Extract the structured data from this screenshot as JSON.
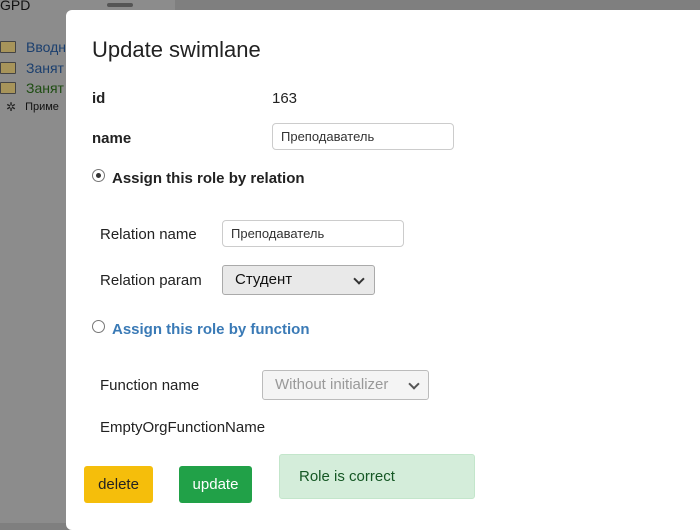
{
  "background": {
    "title": "GPD",
    "items": [
      {
        "label": "Вводн"
      },
      {
        "label": "Занят"
      },
      {
        "label": "Занят"
      },
      {
        "label": "Приме"
      }
    ]
  },
  "modal": {
    "title": "Update swimlane",
    "id": {
      "label": "id",
      "value": "163"
    },
    "name": {
      "label": "name",
      "value": "Преподаватель"
    },
    "relation_option": {
      "label": "Assign this role by relation",
      "checked": true
    },
    "relation_name": {
      "label": "Relation name",
      "value": "Преподаватель"
    },
    "relation_param": {
      "label": "Relation param",
      "selected": "Студент"
    },
    "function_option": {
      "label": "Assign this role by function",
      "checked": false
    },
    "function_name": {
      "label": "Function name",
      "selected": "Without initializer",
      "disabled": true
    },
    "function_value": "EmptyOrgFunctionName",
    "buttons": {
      "delete": "delete",
      "update": "update"
    },
    "status": "Role is correct"
  },
  "colors": {
    "delete_button": "#f5be0b",
    "update_button": "#21a148",
    "link_blue": "#3a7ab6",
    "success_bg": "#d4edda",
    "success_text": "#155724"
  }
}
